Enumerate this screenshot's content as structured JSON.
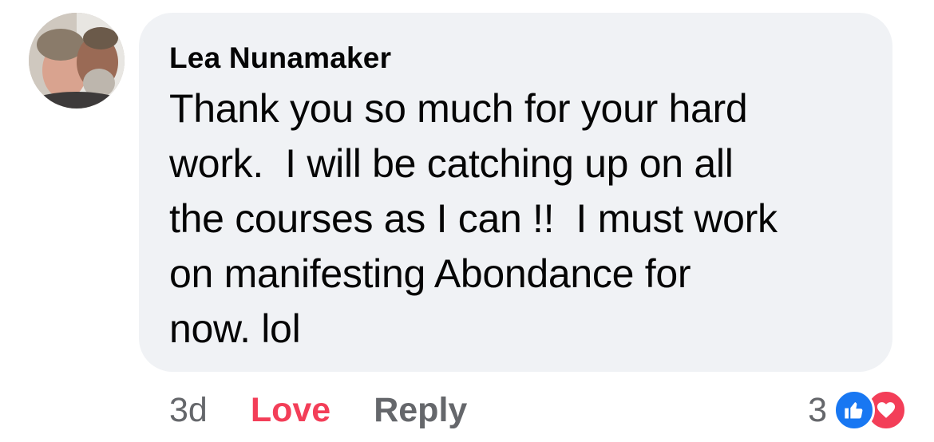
{
  "comment": {
    "author": "Lea Nunamaker",
    "text": "Thank you so much for your hard\nwork.  I will be catching up on all\nthe courses as I can !!  I must work\non manifesting Abondance for\nnow. lol",
    "avatar_icon": "profile-photo"
  },
  "actions": {
    "timestamp": "3d",
    "love_label": "Love",
    "reply_label": "Reply"
  },
  "reactions": {
    "count": "3",
    "icons": [
      "like-icon",
      "heart-icon"
    ],
    "colors": {
      "like": "#1877f2",
      "heart": "#f33e58"
    }
  },
  "colors": {
    "bubble_bg": "#f0f2f5",
    "text": "#050505",
    "muted": "#65676b",
    "love": "#f33e58"
  }
}
